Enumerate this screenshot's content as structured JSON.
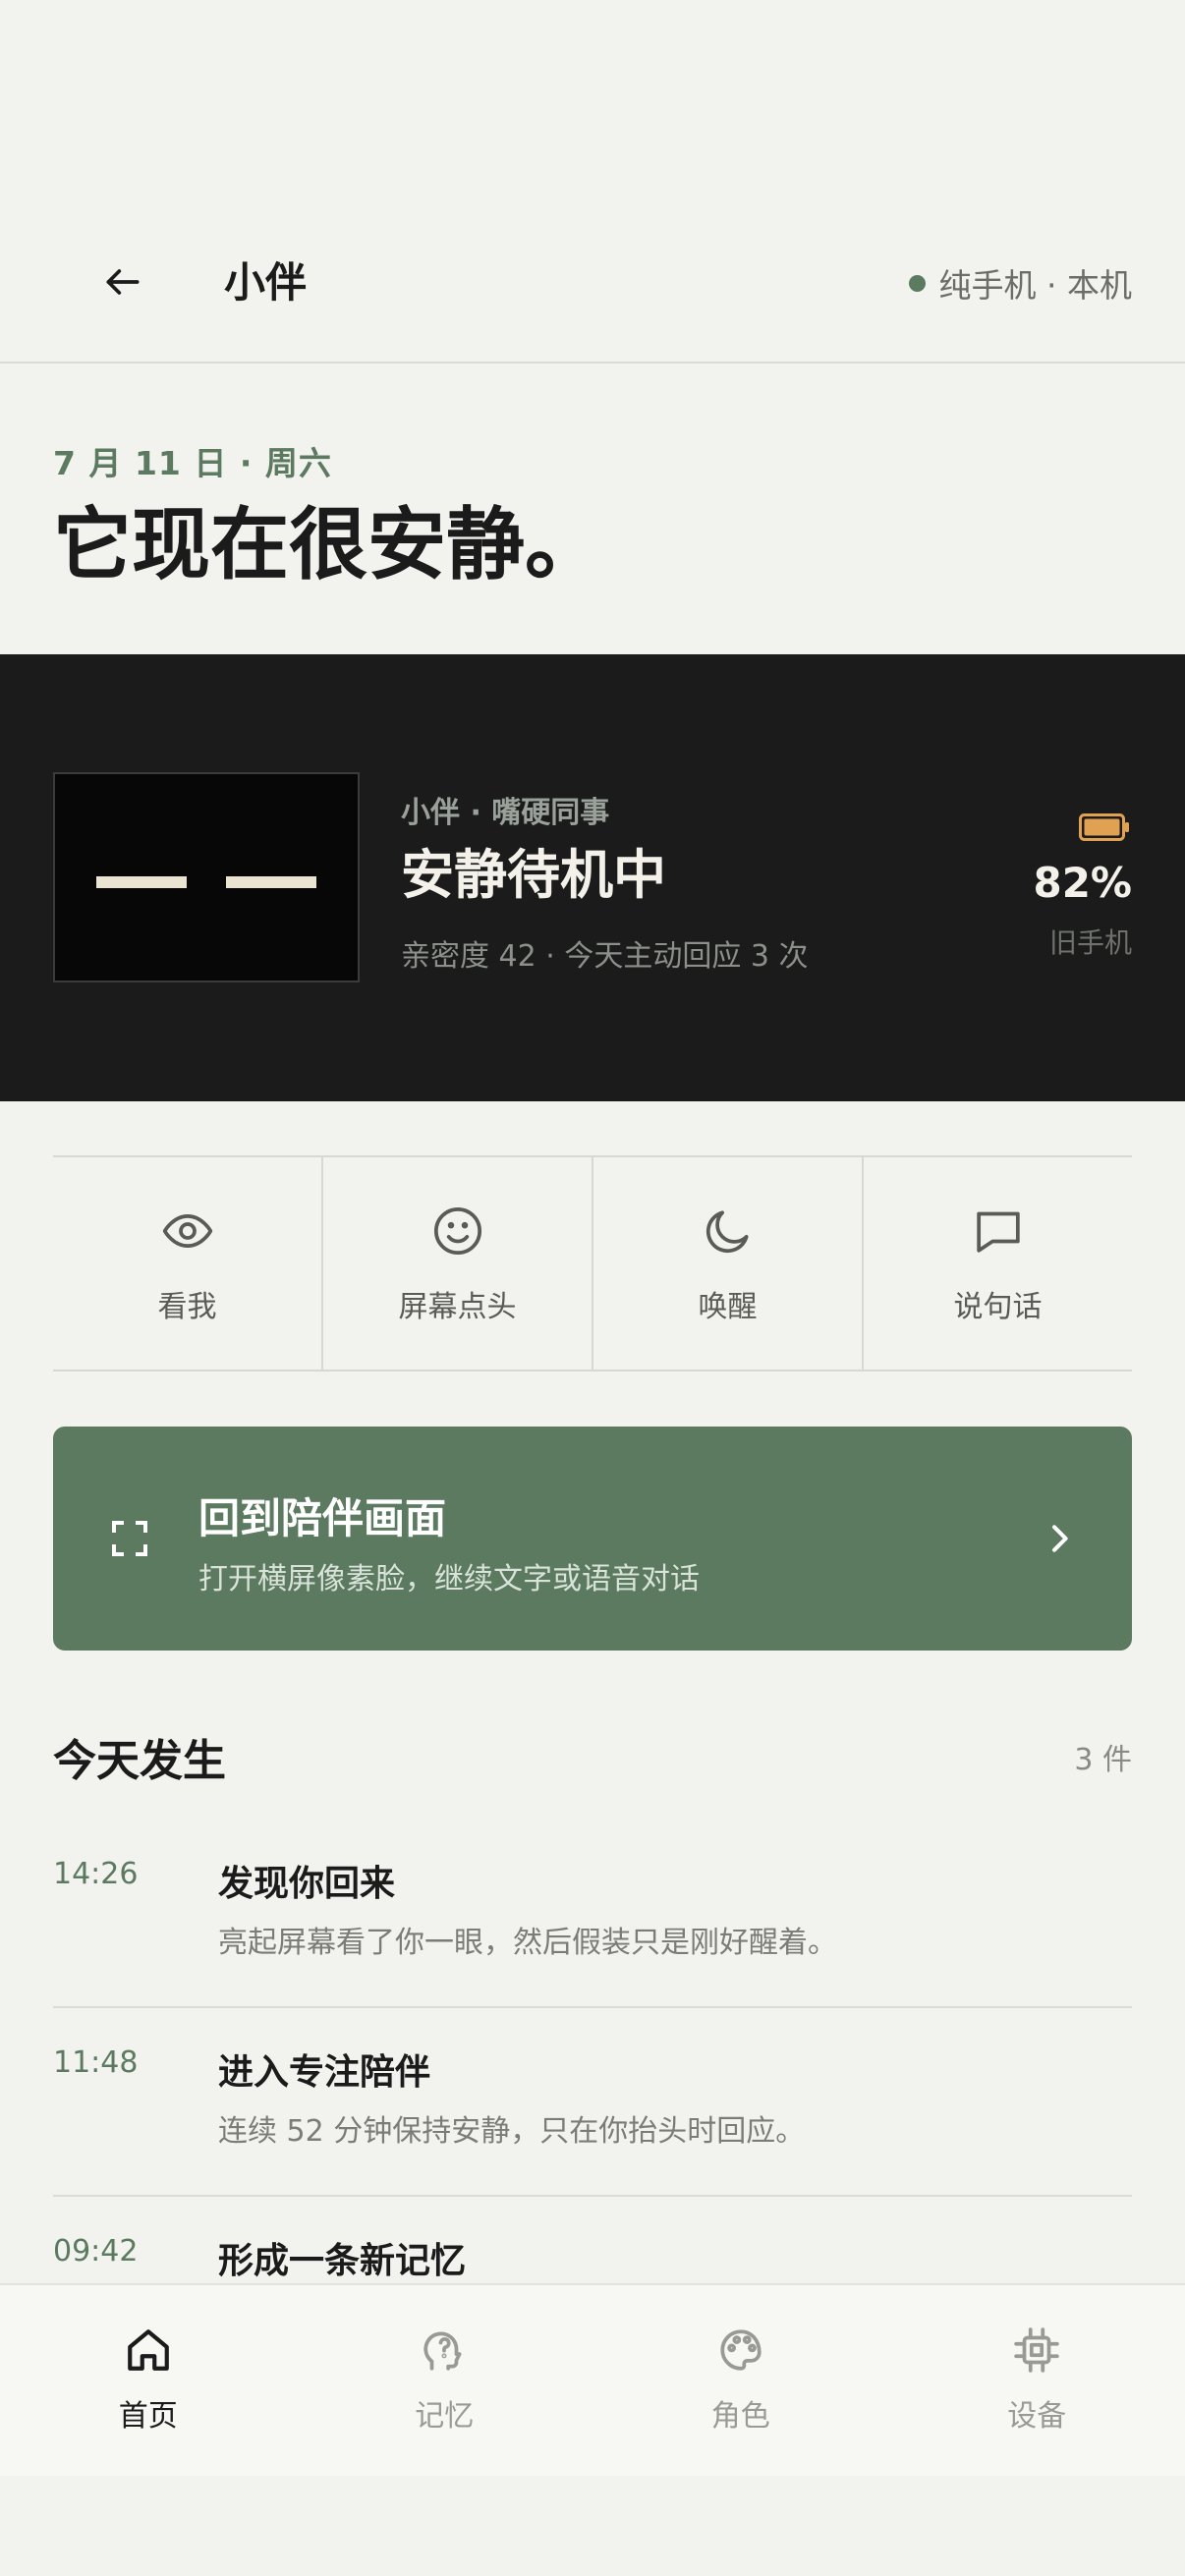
{
  "header": {
    "title": "小伴",
    "device_status": "纯手机 · 本机",
    "status_color": "#5b7a60"
  },
  "hero": {
    "date": "7 月 11 日 · 周六",
    "title": "它现在很安静。"
  },
  "status_card": {
    "subtitle": "小伴 · 嘴硬同事",
    "title": "安静待机中",
    "meta": "亲密度 42 · 今天主动回应 3 次",
    "battery_percent": "82%",
    "battery_level": 0.82,
    "battery_label": "旧手机",
    "battery_color": "#e0a152"
  },
  "actions": [
    {
      "label": "看我",
      "icon": "eye-icon"
    },
    {
      "label": "屏幕点头",
      "icon": "smile-icon"
    },
    {
      "label": "唤醒",
      "icon": "moon-icon"
    },
    {
      "label": "说句话",
      "icon": "chat-icon"
    }
  ],
  "resume": {
    "title": "回到陪伴画面",
    "subtitle": "打开横屏像素脸，继续文字或语音对话",
    "color": "#5b7a60"
  },
  "today": {
    "title": "今天发生",
    "count": "3 件",
    "events": [
      {
        "time": "14:26",
        "title": "发现你回来",
        "desc": "亮起屏幕看了你一眼，然后假装只是刚好醒着。"
      },
      {
        "time": "11:48",
        "title": "进入专注陪伴",
        "desc": "连续 52 分钟保持安静，只在你抬头时回应。"
      },
      {
        "time": "09:42",
        "title": "形成一条新记忆",
        "desc": ""
      }
    ]
  },
  "nav": [
    {
      "label": "首页",
      "icon": "home-icon",
      "active": true
    },
    {
      "label": "记忆",
      "icon": "memory-icon",
      "active": false
    },
    {
      "label": "角色",
      "icon": "palette-icon",
      "active": false
    },
    {
      "label": "设备",
      "icon": "chip-icon",
      "active": false
    }
  ]
}
